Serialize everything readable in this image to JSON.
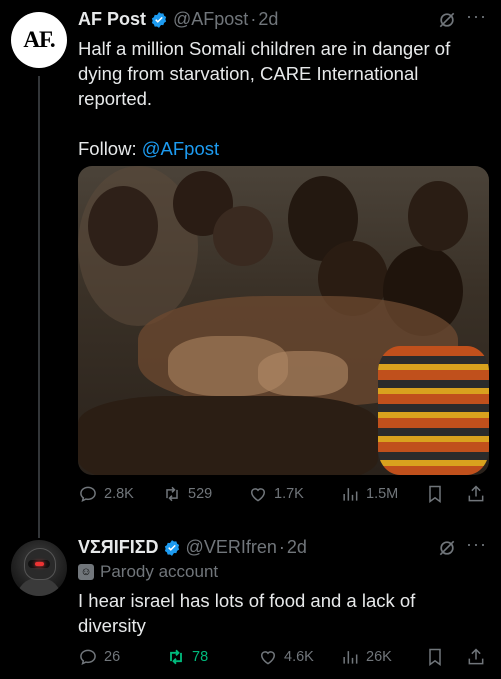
{
  "colors": {
    "background": "#000000",
    "text": "#e7e9ea",
    "muted": "#71767b",
    "link": "#1d9bf0",
    "verified": "#1d9bf0",
    "repost_active": "#00ba7c"
  },
  "post": {
    "avatar_text": "AF.",
    "name": "AF Post",
    "handle": "@AFpost",
    "separator": "·",
    "time": "2d",
    "text_line1": "Half a million Somali children are in danger of",
    "text_line2": "dying from starvation, CARE International",
    "text_line3": "reported.",
    "follow_label": "Follow: ",
    "follow_link": "@AFpost",
    "stats": {
      "replies": "2.8K",
      "reposts": "529",
      "likes": "1.7K",
      "views": "1.5M"
    }
  },
  "reply": {
    "name": "VΣЯIFIΣD",
    "handle": "@VERIfren",
    "separator": "·",
    "time": "2d",
    "label": "Parody account",
    "text_line1": "I hear israel has lots of food and a lack of",
    "text_line2": "diversity",
    "stats": {
      "replies": "26",
      "reposts": "78",
      "likes": "4.6K",
      "views": "26K"
    }
  }
}
